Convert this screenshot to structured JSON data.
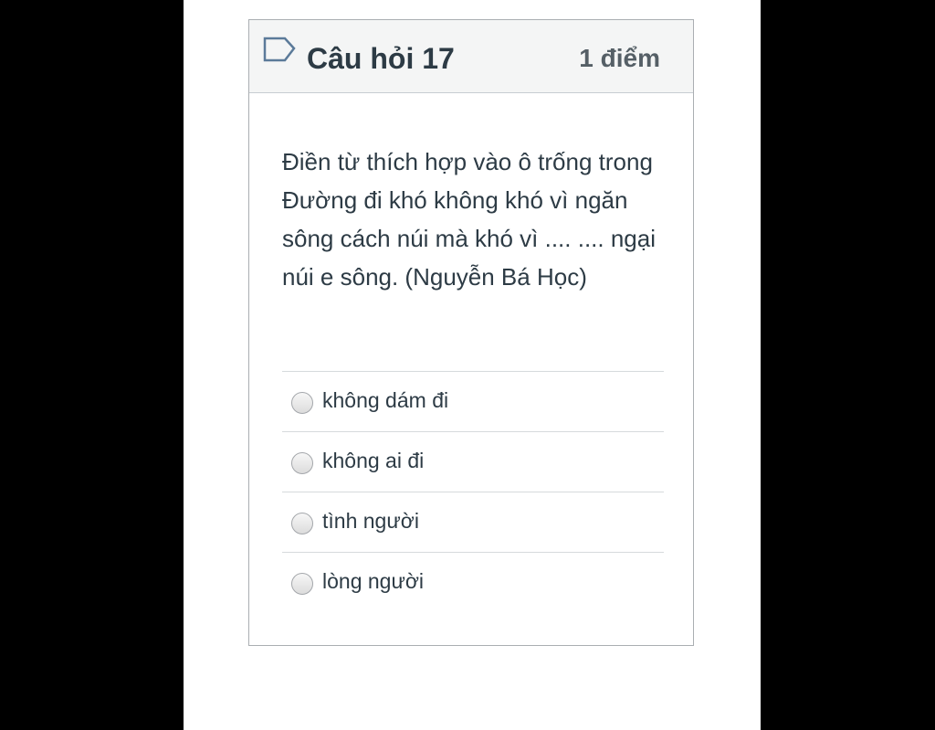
{
  "question": {
    "title": "Câu hỏi 17",
    "points": "1 điểm",
    "text": "Điền từ thích hợp vào ô trống trong Đường đi khó không khó vì ngăn sông cách núi mà khó vì .... .... ngại núi e sông. (Nguyễn Bá Học)",
    "flag_icon": "flag-outline-icon"
  },
  "answers": [
    {
      "label": "không dám đi",
      "selected": false
    },
    {
      "label": "không ai đi",
      "selected": false
    },
    {
      "label": "tình người",
      "selected": false
    },
    {
      "label": "lòng người",
      "selected": false
    }
  ],
  "colors": {
    "header_bg": "#f4f5f5",
    "text": "#2d3b45",
    "border": "#aaaeb2",
    "divider": "#d6dadc",
    "outer_bg": "#000000"
  }
}
